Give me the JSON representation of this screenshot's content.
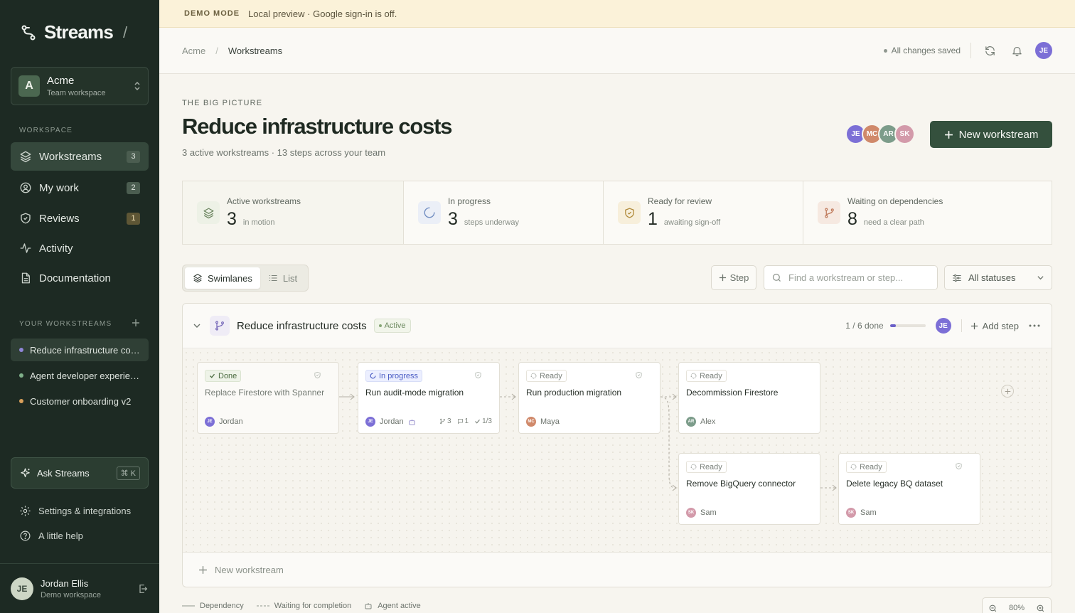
{
  "banner": {
    "tag": "DEMO MODE",
    "text": "Local preview · Google sign-in is off."
  },
  "sidebar": {
    "brand": "Streams",
    "brand_sep": "/",
    "workspace": {
      "initial": "A",
      "name": "Acme",
      "sub": "Team workspace"
    },
    "section_workspace": "WORKSPACE",
    "nav": [
      {
        "label": "Workstreams",
        "count": "3",
        "icon": "layers-icon"
      },
      {
        "label": "My work",
        "count": "2",
        "icon": "user-circle-icon"
      },
      {
        "label": "Reviews",
        "count": "1",
        "icon": "shield-icon"
      },
      {
        "label": "Activity",
        "icon": "activity-icon"
      },
      {
        "label": "Documentation",
        "icon": "document-icon"
      }
    ],
    "section_yours": "YOUR WORKSTREAMS",
    "workstreams": [
      {
        "label": "Reduce infrastructure costs",
        "color": "#8f86d8"
      },
      {
        "label": "Agent developer experience",
        "color": "#7fb08a"
      },
      {
        "label": "Customer onboarding v2",
        "color": "#d9a05b"
      }
    ],
    "ask": {
      "label": "Ask Streams",
      "shortcut": "⌘ K"
    },
    "settings": "Settings & integrations",
    "help": "A little help",
    "user": {
      "initials": "JE",
      "name": "Jordan Ellis",
      "sub": "Demo workspace"
    }
  },
  "topbar": {
    "crumbs": [
      "Acme",
      "Workstreams"
    ],
    "crumb_sep": "/",
    "saved": "All changes saved",
    "user_initials": "JE"
  },
  "page": {
    "eyebrow": "THE BIG PICTURE",
    "title": "Reduce infrastructure costs",
    "subtitle": "3 active workstreams · 13 steps across your team",
    "team": [
      {
        "initials": "JE",
        "color": "#7c6fd6"
      },
      {
        "initials": "MC",
        "color": "#d0896a"
      },
      {
        "initials": "AR",
        "color": "#7c9c8a"
      },
      {
        "initials": "SK",
        "color": "#d39aaa"
      }
    ],
    "new_button": "New workstream"
  },
  "stats": [
    {
      "label": "Active workstreams",
      "value": "3",
      "sub": "in motion"
    },
    {
      "label": "In progress",
      "value": "3",
      "sub": "steps underway"
    },
    {
      "label": "Ready for review",
      "value": "1",
      "sub": "awaiting sign-off"
    },
    {
      "label": "Waiting on dependencies",
      "value": "8",
      "sub": "need a clear path"
    }
  ],
  "toolbar": {
    "tabs": [
      "Swimlanes",
      "List"
    ],
    "step_button": "Step",
    "search_placeholder": "Find a workstream or step...",
    "filter": "All statuses"
  },
  "board": {
    "title": "Reduce infrastructure costs",
    "status": "Active",
    "progress_text": "1 / 6 done",
    "progress_fraction": 0.167,
    "owner_initials": "JE",
    "add_step": "Add step",
    "cards": [
      {
        "status": "Done",
        "title": "Replace Firestore with Spanner",
        "assignee": "Jordan",
        "initials": "JE",
        "color": "#7c6fd6"
      },
      {
        "status": "In progress",
        "title": "Run audit-mode migration",
        "assignee": "Jordan",
        "initials": "JE",
        "color": "#7c6fd6",
        "meta": [
          "3",
          "1",
          "1/3"
        ]
      },
      {
        "status": "Ready",
        "title": "Run production migration",
        "assignee": "Maya",
        "initials": "MC",
        "color": "#d0896a"
      },
      {
        "status": "Ready",
        "title": "Decommission Firestore",
        "assignee": "Alex",
        "initials": "AR",
        "color": "#7c9c8a"
      },
      {
        "status": "Ready",
        "title": "Remove BigQuery connector",
        "assignee": "Sam",
        "initials": "SK",
        "color": "#d39aaa"
      },
      {
        "status": "Ready",
        "title": "Delete legacy BQ dataset",
        "assignee": "Sam",
        "initials": "SK",
        "color": "#d39aaa"
      }
    ],
    "new_workstream": "New workstream"
  },
  "legend": [
    "Dependency",
    "Waiting for completion",
    "Agent active"
  ],
  "zoom": {
    "level": "80%"
  }
}
